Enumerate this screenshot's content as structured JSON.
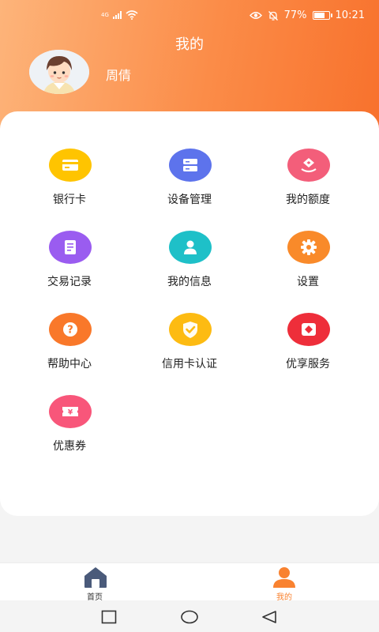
{
  "status_bar": {
    "network_label": "4G",
    "battery_text": "77%",
    "battery_level": 0.77,
    "time": "10:21",
    "icons": [
      "signal-icon",
      "wifi-icon",
      "eye-icon",
      "mute-bell-icon",
      "battery-icon"
    ]
  },
  "header": {
    "title": "我的",
    "user_name": "周倩",
    "gradient_colors": [
      "#fdb47a",
      "#f8712c"
    ]
  },
  "menu": {
    "items": [
      {
        "label": "银行卡",
        "icon": "bank-card-icon",
        "color": "#ffc400"
      },
      {
        "label": "设备管理",
        "icon": "device-icon",
        "color": "#5d73ec"
      },
      {
        "label": "我的额度",
        "icon": "quota-icon",
        "color": "#f35e7a"
      },
      {
        "label": "交易记录",
        "icon": "record-icon",
        "color": "#9a5cf0"
      },
      {
        "label": "我的信息",
        "icon": "user-info-icon",
        "color": "#1ec0c8"
      },
      {
        "label": "设置",
        "icon": "gear-icon",
        "color": "#f98a2a"
      },
      {
        "label": "帮助中心",
        "icon": "help-icon",
        "color": "#f9782a"
      },
      {
        "label": "信用卡认证",
        "icon": "shield-check-icon",
        "color": "#fdbb12"
      },
      {
        "label": "优享服务",
        "icon": "vip-service-icon",
        "color": "#ee2e3a"
      },
      {
        "label": "优惠券",
        "icon": "coupon-icon",
        "color": "#f8567a"
      }
    ]
  },
  "bottom_nav": {
    "items": [
      {
        "label": "首页",
        "icon": "home-icon",
        "active": false,
        "color": "#4a5a7a"
      },
      {
        "label": "我的",
        "icon": "profile-icon",
        "active": true,
        "color": "#f98230"
      }
    ]
  },
  "system_nav": {
    "buttons": [
      "recent-apps-icon",
      "home-circle-icon",
      "back-icon"
    ]
  }
}
